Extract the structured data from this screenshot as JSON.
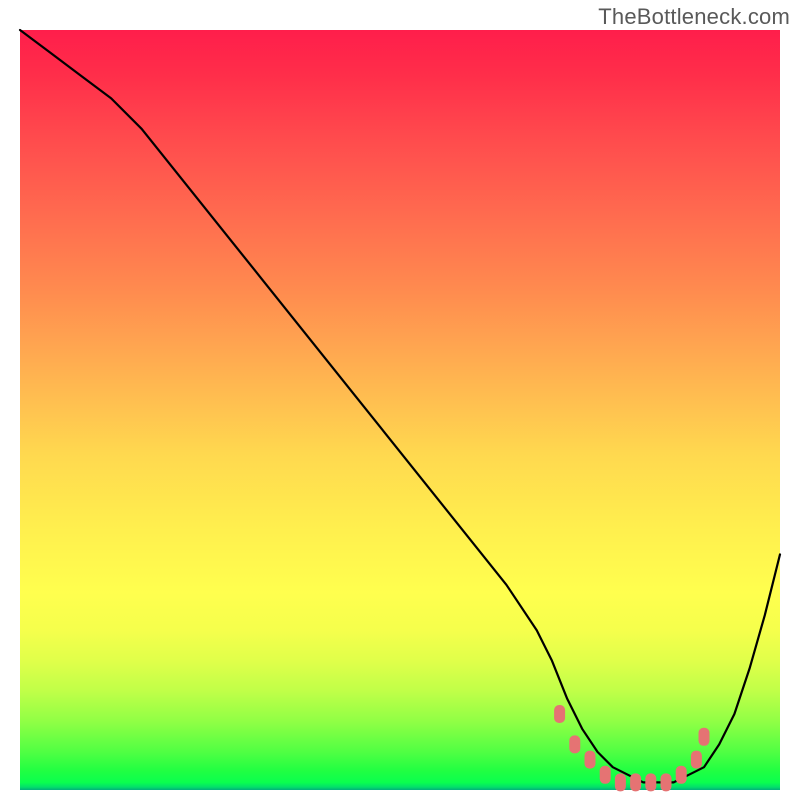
{
  "watermark": "TheBottleneck.com",
  "chart_data": {
    "type": "line",
    "title": "",
    "xlabel": "",
    "ylabel": "",
    "xlim": [
      0,
      100
    ],
    "ylim": [
      0,
      100
    ],
    "grid": false,
    "legend": false,
    "background": "red-yellow-green vertical gradient (bottleneck severity)",
    "series": [
      {
        "name": "bottleneck-curve",
        "color": "#000000",
        "x": [
          0,
          4,
          8,
          12,
          16,
          20,
          24,
          28,
          32,
          36,
          40,
          44,
          48,
          52,
          56,
          60,
          64,
          68,
          70,
          72,
          74,
          76,
          78,
          80,
          82,
          84,
          86,
          88,
          90,
          92,
          94,
          96,
          98,
          100
        ],
        "values": [
          100,
          97,
          94,
          91,
          87,
          82,
          77,
          72,
          67,
          62,
          57,
          52,
          47,
          42,
          37,
          32,
          27,
          21,
          17,
          12,
          8,
          5,
          3,
          2,
          1,
          1,
          1,
          2,
          3,
          6,
          10,
          16,
          23,
          31
        ]
      }
    ],
    "annotations": [
      {
        "name": "optimal-band-markers",
        "type": "marker-run",
        "color": "#e57373",
        "shape": "rounded-rect",
        "x": [
          71,
          73,
          75,
          77,
          79,
          81,
          83,
          85,
          87,
          89,
          90
        ],
        "values": [
          10,
          6,
          4,
          2,
          1,
          1,
          1,
          1,
          2,
          4,
          7
        ]
      }
    ]
  }
}
